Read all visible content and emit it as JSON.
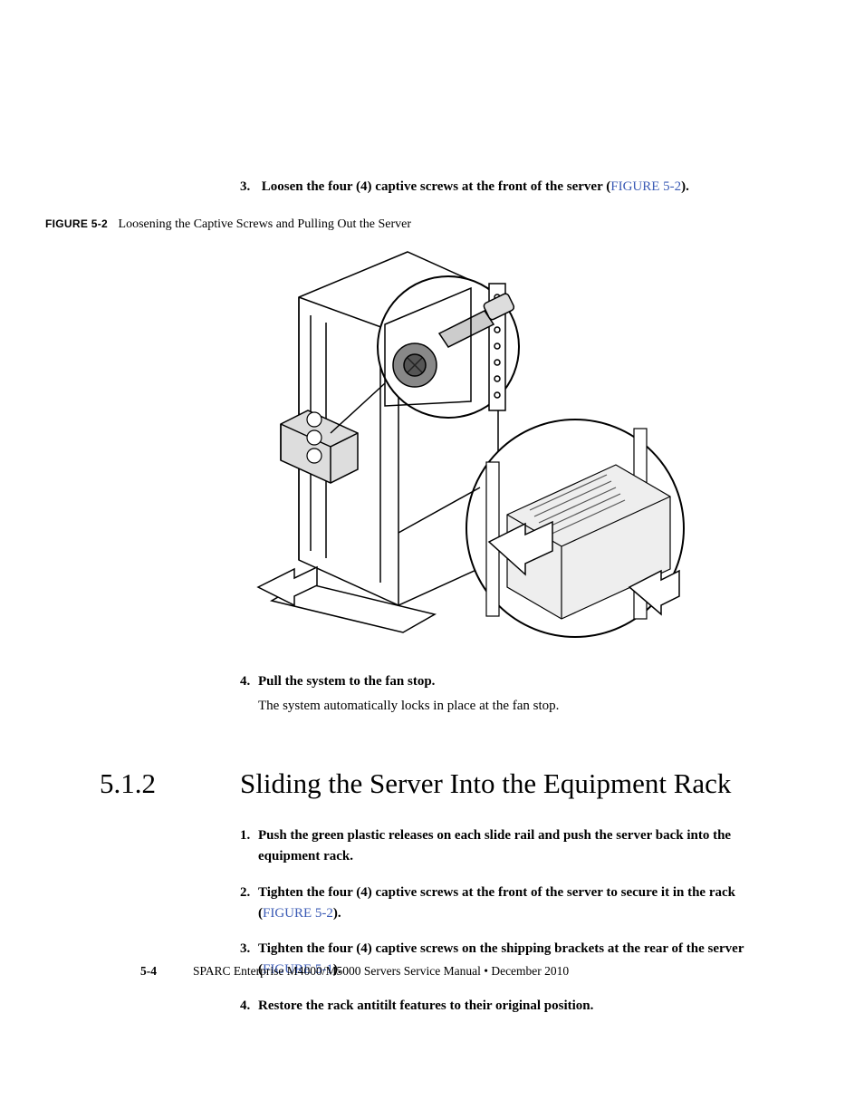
{
  "top_step": {
    "num": "3.",
    "text_prefix": "Loosen the four (4) captive screws at the front of the server (",
    "link": "FIGURE 5-2",
    "text_suffix": ")."
  },
  "figure": {
    "label": "FIGURE 5-2",
    "caption": "Loosening the Captive Screws and Pulling Out the Server"
  },
  "step4": {
    "num": "4.",
    "bold": "Pull the system to the fan stop.",
    "reg": "The system automatically locks in place at the fan stop."
  },
  "section": {
    "num": "5.1.2",
    "title": "Sliding the Server Into the Equipment Rack"
  },
  "list": [
    {
      "num": "1.",
      "pre": "Push the green plastic releases on each slide rail and push the server back into the equipment rack.",
      "link": "",
      "post": ""
    },
    {
      "num": "2.",
      "pre": "Tighten the four (4) captive screws at the front of the server to secure it in the rack (",
      "link": "FIGURE 5-2",
      "post": ")."
    },
    {
      "num": "3.",
      "pre": "Tighten the four (4) captive screws on the shipping brackets at the rear of the server (",
      "link": "FIGURE 5-1",
      "post": ")."
    },
    {
      "num": "4.",
      "pre": "Restore the rack antitilt features to their original position.",
      "link": "",
      "post": ""
    }
  ],
  "footer": {
    "pagenum": "5-4",
    "text": "SPARC Enterprise M4000/M5000 Servers Service Manual • December 2010"
  }
}
